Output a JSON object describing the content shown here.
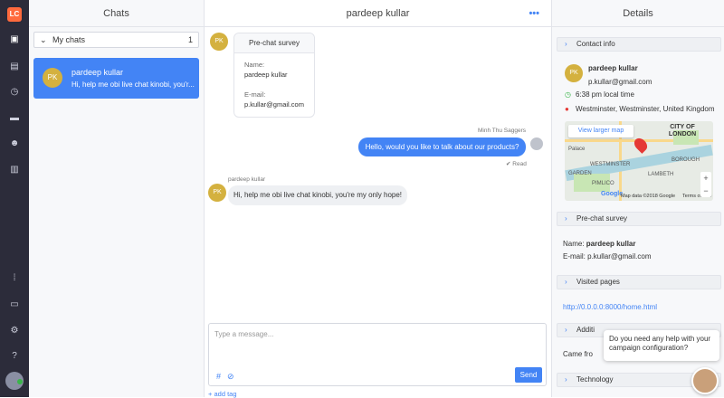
{
  "app": {
    "logo_text": "LC"
  },
  "rail": {
    "icons": [
      "chats-icon",
      "contacts-icon",
      "history-icon",
      "tickets-icon",
      "team-icon",
      "reports-icon",
      "apps-icon",
      "billing-icon",
      "settings-icon",
      "help-icon"
    ]
  },
  "chats": {
    "title": "Chats",
    "my_chats_label": "My chats",
    "my_chats_count": "1",
    "items": [
      {
        "initials": "PK",
        "name": "pardeep kullar",
        "preview": "Hi, help me obi live chat kinobi, you'r..."
      }
    ]
  },
  "conversation": {
    "title": "pardeep kullar",
    "menu_icon": "more-icon",
    "visitor_initials": "PK",
    "survey": {
      "title": "Pre-chat survey",
      "name_label": "Name:",
      "name_value": "pardeep kullar",
      "email_label": "E-mail:",
      "email_value": "p.kullar@gmail.com"
    },
    "messages": [
      {
        "sender": "Minh Thu Saggers",
        "text": "Hello, would you like to talk about our products?",
        "status": "Read",
        "status_icon": "✔"
      },
      {
        "sender": "pardeep kullar",
        "text": "Hi, help me obi live chat kinobi, you're my only hope!"
      }
    ],
    "composer": {
      "placeholder": "Type a message...",
      "send_label": "Send",
      "hash_icon": "#",
      "attach_icon": "⊘",
      "add_tag": "add tag",
      "add_tag_icon": "+"
    }
  },
  "details": {
    "title": "Details",
    "contact_info": {
      "header": "Contact info",
      "initials": "PK",
      "name": "pardeep kullar",
      "email": "p.kullar@gmail.com",
      "local_time": "6:38 pm local time",
      "location": "Westminster, Westminster, United Kingdom"
    },
    "map": {
      "view_larger": "View larger map",
      "labels": [
        "CITY OF",
        "LONDON",
        "Palace",
        "WESTMINSTER",
        "LAMBETH",
        "PIMLICO",
        "BOROUGH",
        "GARDEN"
      ],
      "attribution": "Map data ©2018 Google",
      "terms": "Terms of Use",
      "google": "Google"
    },
    "prechat": {
      "header": "Pre-chat survey",
      "name_label": "Name:",
      "name_value": "pardeep kullar",
      "email_label": "E-mail:",
      "email_value": "p.kullar@gmail.com"
    },
    "visited": {
      "header": "Visited pages",
      "url": "http://0.0.0.0:8000/home.html"
    },
    "additional": {
      "header": "Additi",
      "came_from": "Came fro"
    },
    "technology": {
      "header": "Technology"
    }
  },
  "help_popup": {
    "text": "Do you need any help with your campaign configuration?"
  }
}
